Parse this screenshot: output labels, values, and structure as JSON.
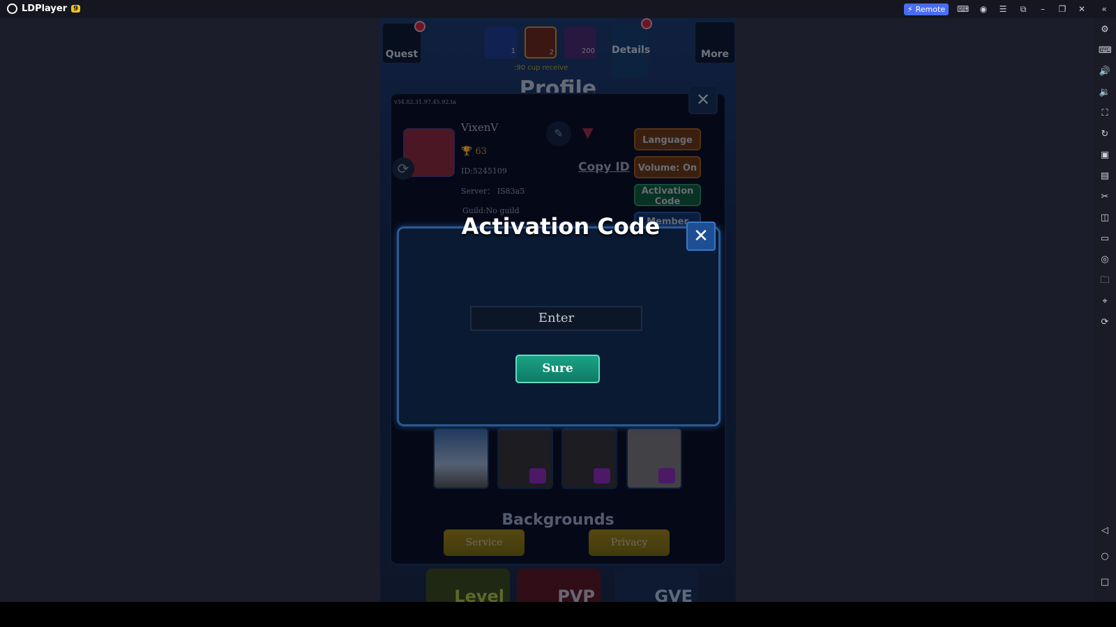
{
  "app": {
    "title": "LDPlayer",
    "vip_badge": "9",
    "remote_label": "Remote"
  },
  "titlebar_icons": [
    "gamepad-icon",
    "account-icon",
    "menu-icon",
    "screen-icon",
    "minimize-icon",
    "restore-icon",
    "close-icon",
    "collapse-icon"
  ],
  "sidebar_icons": [
    "settings-icon",
    "keyboard-icon",
    "volume-up-icon",
    "volume-down-icon",
    "fullscreen-icon",
    "sync-icon",
    "screenshot-icon",
    "apk-icon",
    "cut-icon",
    "multi-instance-icon",
    "operations-icon",
    "shake-icon",
    "folder-icon",
    "location-icon",
    "rotate-icon"
  ],
  "nav_icons": [
    "back-icon",
    "home-icon",
    "recents-icon"
  ],
  "game": {
    "quest": "Quest",
    "more": "More",
    "details": "Details",
    "resources": [
      {
        "icon": "card-icon",
        "count": "1"
      },
      {
        "icon": "medal-icon",
        "count": "2"
      },
      {
        "icon": "coin-icon",
        "count": "200"
      }
    ],
    "cup_text": ":90 cup receive",
    "profile_title": "Profile",
    "version": "v34.82.31.97.45.92.ta",
    "username": "VixenV",
    "trophies": "63",
    "id": "ID:5245109",
    "server": "Server： IS83a5",
    "guild": "Guild:No guild",
    "copy_id": "Copy ID",
    "buttons": {
      "language": "Language",
      "volume": "Volume: On",
      "activation": "Activation Code",
      "member": "Member"
    },
    "backgrounds_label": "Backgrounds",
    "service": "Service",
    "privacy": "Privacy",
    "modes": [
      "Level",
      "PVP",
      "GVE"
    ]
  },
  "dialog": {
    "title": "Activation Code",
    "input_placeholder": "Enter",
    "sure": "Sure"
  }
}
